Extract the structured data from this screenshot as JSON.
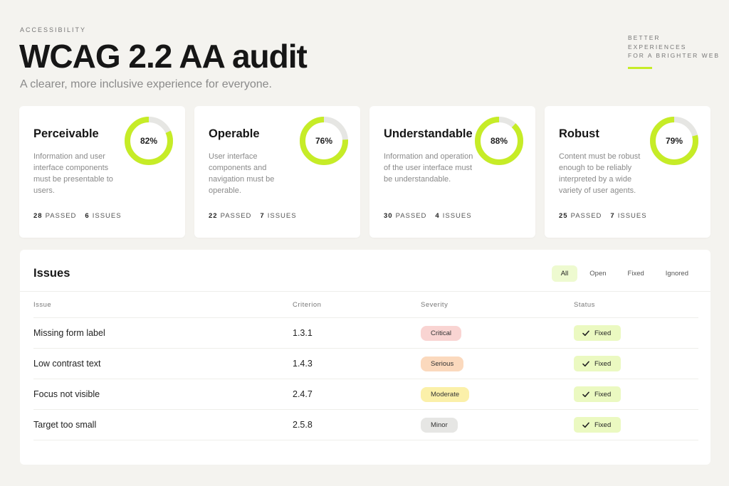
{
  "header": {
    "eyebrow": "ACCESSIBILITY",
    "title": "WCAG 2.2 AA audit",
    "subtitle": "A clearer, more inclusive experience for everyone.",
    "tagline": [
      "BETTER",
      "EXPERIENCES",
      "FOR A BRIGHTER WEB"
    ]
  },
  "cards": [
    {
      "title": "Perceivable",
      "description": "Information and user interface components must be presentable to users.",
      "score": 0.82,
      "score_label": "82%",
      "passed": "28",
      "passed_label": "PASSED",
      "issues": "6",
      "issues_label": "ISSUES"
    },
    {
      "title": "Operable",
      "description": "User interface components and navigation must be operable.",
      "score": 0.76,
      "score_label": "76%",
      "passed": "22",
      "passed_label": "PASSED",
      "issues": "7",
      "issues_label": "ISSUES"
    },
    {
      "title": "Understandable",
      "description": "Information and operation of the user interface must be understandable.",
      "score": 0.88,
      "score_label": "88%",
      "passed": "30",
      "passed_label": "PASSED",
      "issues": "4",
      "issues_label": "ISSUES"
    },
    {
      "title": "Robust",
      "description": "Content must be robust enough to be reliably interpreted by a wide variety of user agents.",
      "score": 0.79,
      "score_label": "79%",
      "passed": "25",
      "passed_label": "PASSED",
      "issues": "7",
      "issues_label": "ISSUES"
    }
  ],
  "issues": {
    "title": "Issues",
    "filters": [
      {
        "label": "All",
        "active": true
      },
      {
        "label": "Open",
        "active": false
      },
      {
        "label": "Fixed",
        "active": false
      },
      {
        "label": "Ignored",
        "active": false
      }
    ],
    "columns": [
      "Issue",
      "Criterion",
      "Severity",
      "Status"
    ],
    "rows": [
      {
        "issue": "Missing form label",
        "criterion": "1.3.1",
        "severity": "Critical",
        "status": "Fixed"
      },
      {
        "issue": "Low contrast text",
        "criterion": "1.4.3",
        "severity": "Serious",
        "status": "Fixed"
      },
      {
        "issue": "Focus not visible",
        "criterion": "2.4.7",
        "severity": "Moderate",
        "status": "Fixed"
      },
      {
        "issue": "Target too small",
        "criterion": "2.5.8",
        "severity": "Minor",
        "status": "Fixed"
      }
    ]
  },
  "colors": {
    "accent": "#c6ec27",
    "track": "#e6e6e3",
    "severity": {
      "Critical": "#f9d4d2",
      "Serious": "#fbd9bd",
      "Moderate": "#fbf0a9",
      "Minor": "#e6e6e4"
    }
  }
}
